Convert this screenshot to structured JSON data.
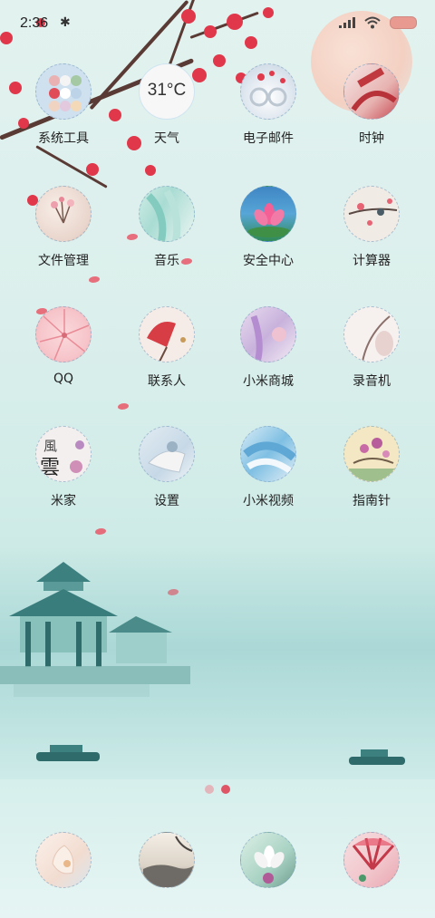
{
  "status_bar": {
    "time": "2:36",
    "bluetooth_icon": "bluetooth-icon",
    "signal_icon": "signal-icon",
    "wifi_icon": "wifi-icon",
    "battery_icon": "battery-icon"
  },
  "weather_widget": {
    "temperature": "31°C"
  },
  "apps": [
    {
      "label": "系统工具",
      "icon": "folder-icon"
    },
    {
      "label": "天气",
      "icon": "weather-icon"
    },
    {
      "label": "电子邮件",
      "icon": "email-icon"
    },
    {
      "label": "时钟",
      "icon": "clock-icon"
    },
    {
      "label": "文件管理",
      "icon": "file-manager-icon"
    },
    {
      "label": "音乐",
      "icon": "music-icon"
    },
    {
      "label": "安全中心",
      "icon": "security-icon"
    },
    {
      "label": "计算器",
      "icon": "calculator-icon"
    },
    {
      "label": "QQ",
      "icon": "qq-icon"
    },
    {
      "label": "联系人",
      "icon": "contacts-icon"
    },
    {
      "label": "小米商城",
      "icon": "mi-store-icon"
    },
    {
      "label": "录音机",
      "icon": "recorder-icon"
    },
    {
      "label": "米家",
      "icon": "mijia-icon"
    },
    {
      "label": "设置",
      "icon": "settings-icon"
    },
    {
      "label": "小米视频",
      "icon": "mi-video-icon"
    },
    {
      "label": "指南针",
      "icon": "compass-icon"
    }
  ],
  "page_indicator": {
    "pages": 2,
    "active": 2
  },
  "dock": [
    {
      "icon": "phone-icon"
    },
    {
      "icon": "messages-icon"
    },
    {
      "icon": "browser-icon"
    },
    {
      "icon": "camera-icon"
    }
  ],
  "colors": {
    "blossom": "#e0374b",
    "branch": "#5a3a34",
    "accent": "#e89a91"
  }
}
